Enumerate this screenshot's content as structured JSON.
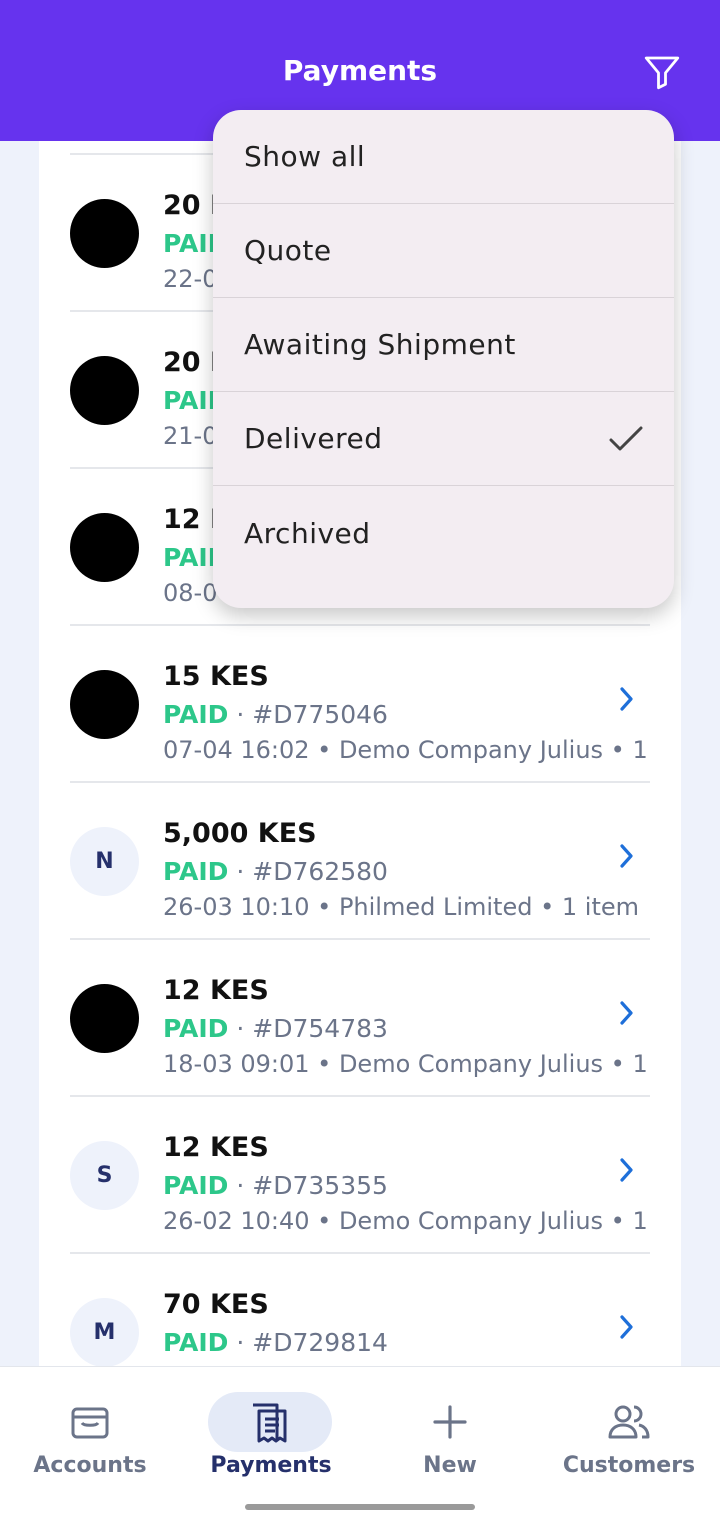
{
  "header": {
    "title": "Payments"
  },
  "colors": {
    "header": "#6633EE",
    "status_paid": "#2DC78A",
    "chevron": "#1E6FD9",
    "nav_active": "#25306B"
  },
  "payments": [
    {
      "amount": "20 KES",
      "status": "PAID",
      "id": "",
      "meta": "22-0",
      "avatar": ""
    },
    {
      "amount": "20 KES",
      "status": "PAID",
      "id": "",
      "meta": "21-0",
      "avatar": ""
    },
    {
      "amount": "12 KES",
      "status": "PAID",
      "id": "",
      "meta": "08-04",
      "avatar": ""
    },
    {
      "amount": "15 KES",
      "status": "PAID",
      "id": "#D775046",
      "meta": "07-04 16:02 • Demo Company Julius • 1",
      "avatar": ""
    },
    {
      "amount": "5,000 KES",
      "status": "PAID",
      "id": "#D762580",
      "meta": "26-03 10:10 • Philmed Limited • 1 item",
      "avatar": "N"
    },
    {
      "amount": "12 KES",
      "status": "PAID",
      "id": "#D754783",
      "meta": "18-03 09:01 • Demo Company Julius • 1",
      "avatar": ""
    },
    {
      "amount": "12 KES",
      "status": "PAID",
      "id": "#D735355",
      "meta": "26-02 10:40 • Demo Company Julius • 1",
      "avatar": "S"
    },
    {
      "amount": "70 KES",
      "status": "PAID",
      "id": "#D729814",
      "meta": "",
      "avatar": "M"
    }
  ],
  "filter_menu": {
    "items": [
      {
        "label": "Show all",
        "checked": false
      },
      {
        "label": "Quote",
        "checked": false
      },
      {
        "label": "Awaiting Shipment",
        "checked": false
      },
      {
        "label": "Delivered",
        "checked": true
      },
      {
        "label": "Archived",
        "checked": false
      }
    ]
  },
  "bottom_nav": {
    "items": [
      {
        "label": "Accounts",
        "icon": "wallet-icon",
        "active": false
      },
      {
        "label": "Payments",
        "icon": "receipt-icon",
        "active": true
      },
      {
        "label": "New",
        "icon": "plus-icon",
        "active": false
      },
      {
        "label": "Customers",
        "icon": "people-icon",
        "active": false
      }
    ]
  }
}
